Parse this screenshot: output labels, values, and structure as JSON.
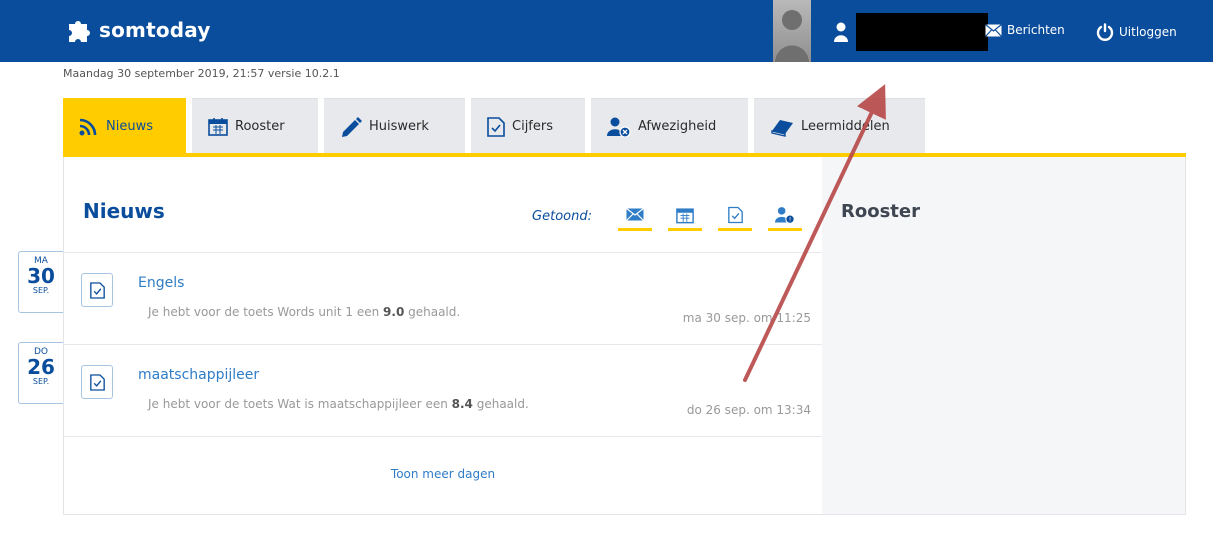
{
  "header": {
    "logo_text": "somtoday",
    "berichten_label": "Berichten",
    "uitloggen_label": "Uitloggen",
    "bg_color": "#0a4d9c"
  },
  "datestamp": "Maandag 30 september 2019, 21:57 versie 10.2.1",
  "tabs": [
    {
      "label": "Nieuws",
      "icon": "rss-icon",
      "active": true
    },
    {
      "label": "Rooster",
      "icon": "calendar-icon"
    },
    {
      "label": "Huiswerk",
      "icon": "pencil-icon"
    },
    {
      "label": "Cijfers",
      "icon": "check-document-icon"
    },
    {
      "label": "Afwezigheid",
      "icon": "person-absent-icon"
    },
    {
      "label": "Leermiddelen",
      "icon": "book-icon"
    }
  ],
  "news": {
    "title": "Nieuws",
    "filters_label": "Getoond:",
    "filters": [
      "mail-icon",
      "calendar-icon",
      "check-document-icon",
      "person-absent-icon"
    ],
    "items": [
      {
        "subject": "Engels",
        "text_before": "Je hebt voor de toets Words unit 1 een ",
        "grade": "9.0",
        "text_after": " gehaald.",
        "time": "ma 30 sep. om 11:25"
      },
      {
        "subject": "maatschappijleer",
        "text_before": "Je hebt voor de toets Wat is maatschappijleer een ",
        "grade": "8.4",
        "text_after": " gehaald.",
        "time": "do 26 sep. om 13:34"
      }
    ],
    "more_label": "Toon meer dagen"
  },
  "date_tabs": [
    {
      "dow": "MA",
      "day": "30",
      "month": "SEP."
    },
    {
      "dow": "DO",
      "day": "26",
      "month": "SEP."
    }
  ],
  "rooster": {
    "title": "Rooster"
  },
  "colors": {
    "accent": "#ffcc00",
    "link": "#2f7cc7",
    "annotation_arrow": "#b84848"
  }
}
